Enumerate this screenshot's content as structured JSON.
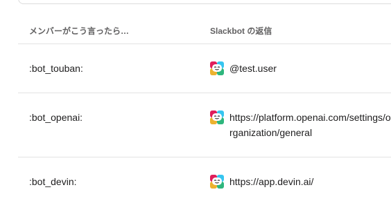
{
  "table": {
    "header": {
      "trigger_label": "メンバーがこう言ったら…",
      "response_label": "Slackbot の返信"
    },
    "rows": [
      {
        "trigger": ":bot_touban:",
        "response": "@test.user",
        "icon": "slackbot-icon"
      },
      {
        "trigger": ":bot_openai:",
        "response": "https://platform.openai.com/settings/organization/general",
        "icon": "slackbot-icon"
      },
      {
        "trigger": ":bot_devin:",
        "response": "https://app.devin.ai/",
        "icon": "slackbot-icon"
      }
    ]
  },
  "colors": {
    "header_text": "#616061",
    "body_text": "#1d1c1d",
    "divider": "#e3e3e3",
    "icon_red": "#e01e5a",
    "icon_blue": "#36c5f0",
    "icon_green": "#2eb67d",
    "icon_yellow": "#ecb22e"
  }
}
